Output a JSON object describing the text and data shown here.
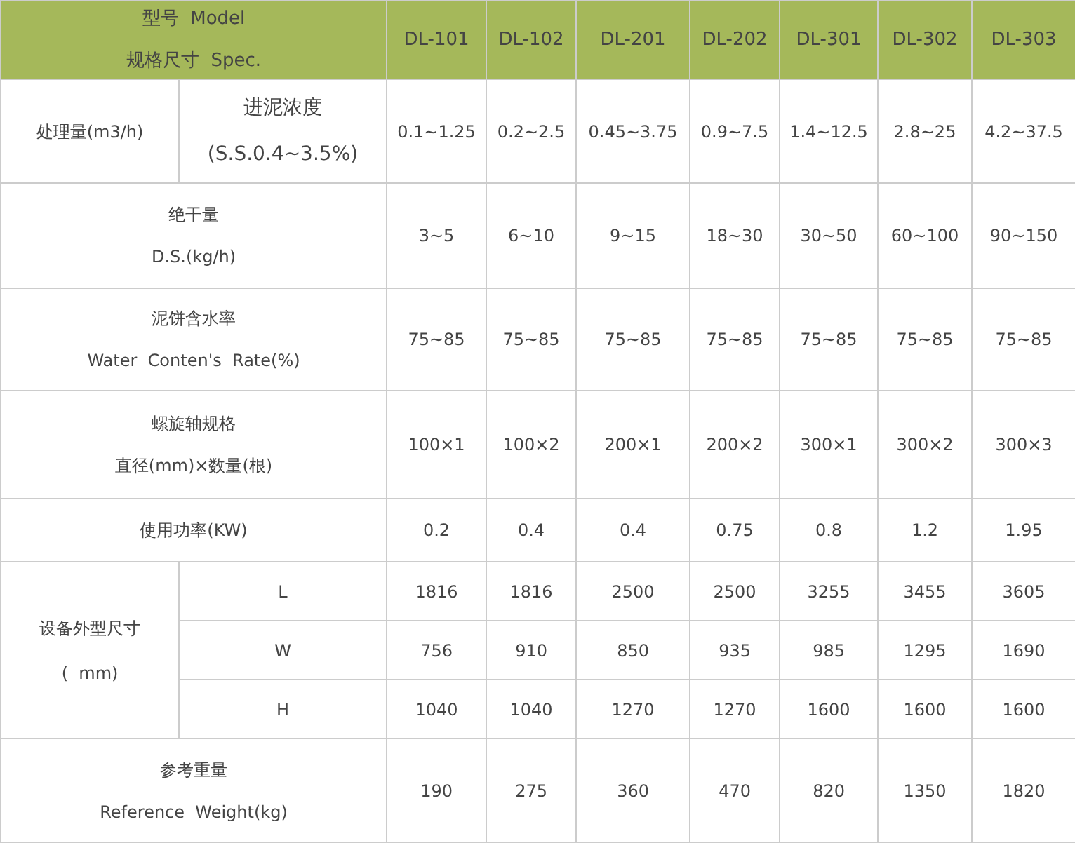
{
  "header": {
    "label_lines": [
      "型号  Model",
      "规格尺寸  Spec."
    ],
    "models": [
      "DL-101",
      "DL-102",
      "DL-201",
      "DL-202",
      "DL-301",
      "DL-302",
      "DL-303"
    ]
  },
  "rows": [
    {
      "kind": "split",
      "label_lines": [
        "处理量(m3/h)"
      ],
      "sub_lines": [
        "进泥浓度",
        "(S.S.0.4~3.5%)"
      ],
      "values": [
        "0.1~1.25",
        "0.2~2.5",
        "0.45~3.75",
        "0.9~7.5",
        "1.4~12.5",
        "2.8~25",
        "4.2~37.5"
      ]
    },
    {
      "kind": "full",
      "label_lines": [
        "绝干量",
        "D.S.(kg/h)"
      ],
      "values": [
        "3~5",
        "6~10",
        "9~15",
        "18~30",
        "30~50",
        "60~100",
        "90~150"
      ]
    },
    {
      "kind": "full",
      "label_lines": [
        "泥饼含水率",
        "Water  Conten's  Rate(%)"
      ],
      "values": [
        "75~85",
        "75~85",
        "75~85",
        "75~85",
        "75~85",
        "75~85",
        "75~85"
      ]
    },
    {
      "kind": "full",
      "label_lines": [
        "螺旋轴规格",
        "直径(mm)×数量(根)"
      ],
      "values": [
        "100×1",
        "100×2",
        "200×1",
        "200×2",
        "300×1",
        "300×2",
        "300×3"
      ]
    },
    {
      "kind": "full",
      "label_lines": [
        "使用功率(KW)"
      ],
      "values": [
        "0.2",
        "0.4",
        "0.4",
        "0.75",
        "0.8",
        "1.2",
        "1.95"
      ]
    },
    {
      "kind": "group",
      "label_lines": [
        "设备外型尺寸",
        "(  mm)"
      ],
      "subrows": [
        {
          "label": "L",
          "values": [
            "1816",
            "1816",
            "2500",
            "2500",
            "3255",
            "3455",
            "3605"
          ]
        },
        {
          "label": "W",
          "values": [
            "756",
            "910",
            "850",
            "935",
            "985",
            "1295",
            "1690"
          ]
        },
        {
          "label": "H",
          "values": [
            "1040",
            "1040",
            "1270",
            "1270",
            "1600",
            "1600",
            "1600"
          ]
        }
      ]
    },
    {
      "kind": "full",
      "label_lines": [
        "参考重量",
        "Reference  Weight(kg)"
      ],
      "values": [
        "190",
        "275",
        "360",
        "470",
        "820",
        "1350",
        "1820"
      ]
    }
  ]
}
